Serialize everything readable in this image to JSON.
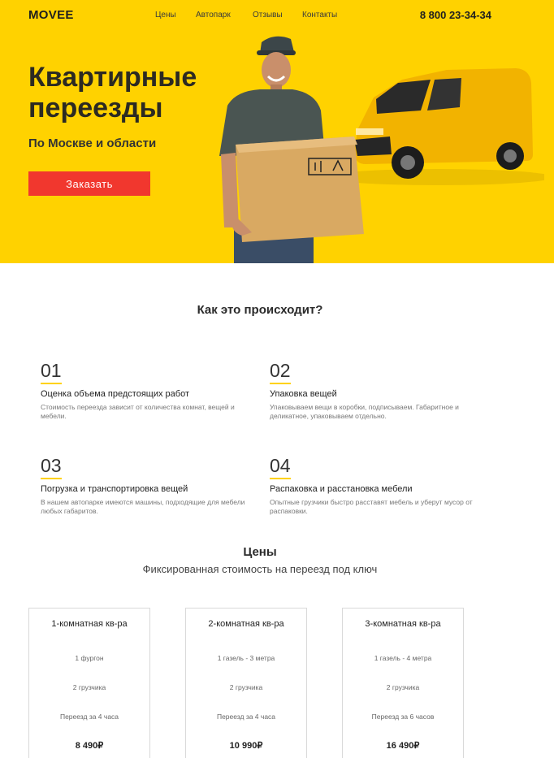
{
  "header": {
    "logo": "MOVEE",
    "nav": [
      "Цены",
      "Автопарк",
      "Отзывы",
      "Контакты"
    ],
    "phone": "8 800 23-34-34"
  },
  "hero": {
    "title_line1": "Квартирные",
    "title_line2": "переезды",
    "subtitle": "По Москве и области",
    "button": "Заказать"
  },
  "how": {
    "title": "Как это происходит?",
    "steps": [
      {
        "num": "01",
        "title": "Оценка объема предстоящих работ",
        "text": "Стоимость переезда зависит от количества комнат, вещей и мебели."
      },
      {
        "num": "02",
        "title": "Упаковка вещей",
        "text": "Упаковываем вещи в коробки, подписываем. Габаритное и деликатное, упаковываем отдельно."
      },
      {
        "num": "03",
        "title": "Погрузка и транспортировка вещей",
        "text": "В нашем автопарке имеются машины, подходящие для мебели любых габаритов."
      },
      {
        "num": "04",
        "title": "Распаковка и расстановка мебели",
        "text": "Опытные грузчики быстро расставят мебель и уберут мусор от распаковки."
      }
    ]
  },
  "prices": {
    "title": "Цены",
    "subtitle": "Фиксированная стоимость на переезд под ключ",
    "cards": [
      {
        "title": "1-комнатная кв-ра",
        "lines": [
          "1 фургон",
          "2 грузчика",
          "Переезд за 4 часа"
        ],
        "price": "8 490₽"
      },
      {
        "title": "2-комнатная кв-ра",
        "lines": [
          "1 газель - 3 метра",
          "2 грузчика",
          "Переезд за 4 часа"
        ],
        "price": "10 990₽"
      },
      {
        "title": "3-комнатная кв-ра",
        "lines": [
          "1 газель - 4 метра",
          "2 грузчика",
          "Переезд за 6 часов"
        ],
        "price": "16 490₽"
      }
    ]
  },
  "colors": {
    "brand_yellow": "#ffd200",
    "button_red": "#f1372e"
  }
}
